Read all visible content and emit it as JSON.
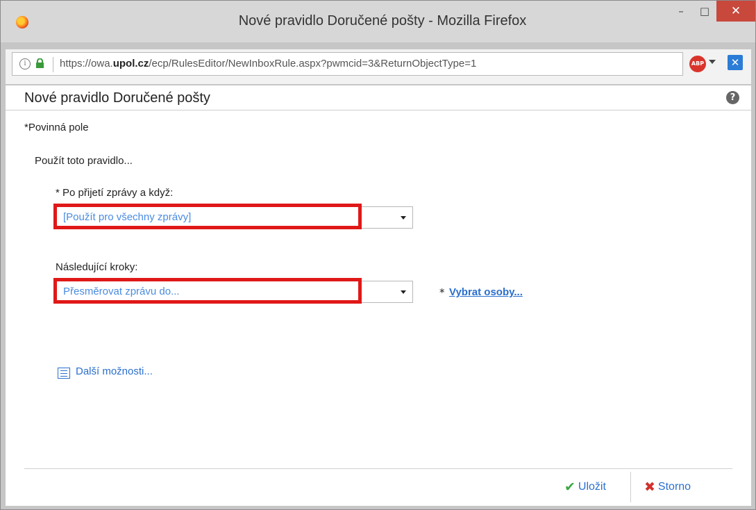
{
  "window": {
    "title": "Nové pravidlo Doručené pošty - Mozilla Firefox",
    "minimize": "–",
    "maximize": "□",
    "close": "✕"
  },
  "address": {
    "url_prefix": "https://owa.",
    "url_domain": "upol.cz",
    "url_path": "/ecp/RulesEditor/NewInboxRule.aspx?pwmcid=3&ReturnObjectType=1",
    "info_glyph": "i",
    "abp_label": "ABP"
  },
  "page": {
    "title": "Nové pravidlo Doručené pošty",
    "help_glyph": "?",
    "required_note": "*Povinná pole",
    "apply_rule": "Použít toto pravidlo...",
    "condition_label": "* Po přijetí zprávy a když:",
    "condition_value": "[Použít pro všechny zprávy]",
    "action_label": "Následující kroky:",
    "action_value": "Přesměrovat zprávu do...",
    "select_people_star": "*",
    "select_people_link": "Vybrat osoby...",
    "more_options": "Další možnosti..."
  },
  "buttons": {
    "save": "Uložit",
    "cancel": "Storno"
  },
  "colors": {
    "link": "#2a6fce",
    "highlight": "#e01818",
    "close_button": "#c9483c"
  }
}
